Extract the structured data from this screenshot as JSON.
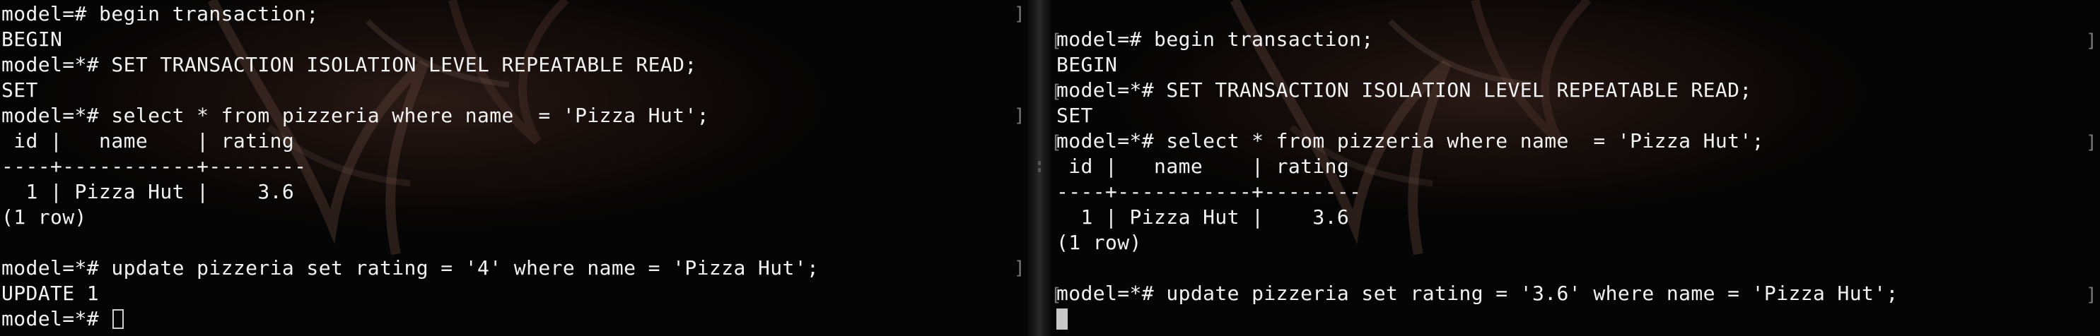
{
  "left_pane": {
    "lines": [
      "model=# begin transaction;",
      "BEGIN",
      "model=*# SET TRANSACTION ISOLATION LEVEL REPEATABLE READ;",
      "SET",
      "model=*# select * from pizzeria where name  = 'Pizza Hut';",
      " id |   name    | rating",
      "----+-----------+--------",
      "  1 | Pizza Hut |    3.6",
      "(1 row)",
      "",
      "model=*# update pizzeria set rating = '4' where name = 'Pizza Hut';",
      "UPDATE 1"
    ],
    "prompt": "model=*# "
  },
  "right_pane": {
    "lines": [
      "model=# begin transaction;",
      "BEGIN",
      "model=*# SET TRANSACTION ISOLATION LEVEL REPEATABLE READ;",
      "SET",
      "model=*# select * from pizzeria where name  = 'Pizza Hut';",
      " id |   name    | rating",
      "----+-----------+--------",
      "  1 | Pizza Hut |    3.6",
      "(1 row)",
      "",
      "model=*# update pizzeria set rating = '3.6' where name = 'Pizza Hut';"
    ]
  },
  "colors": {
    "text": "#f2f2f2",
    "background": "#050505",
    "cursor": "#c8c8c8"
  },
  "icons": {
    "left_cursor": "hollow-block-cursor",
    "right_cursor": "solid-block-cursor",
    "divider": "pane-divider-grip"
  }
}
